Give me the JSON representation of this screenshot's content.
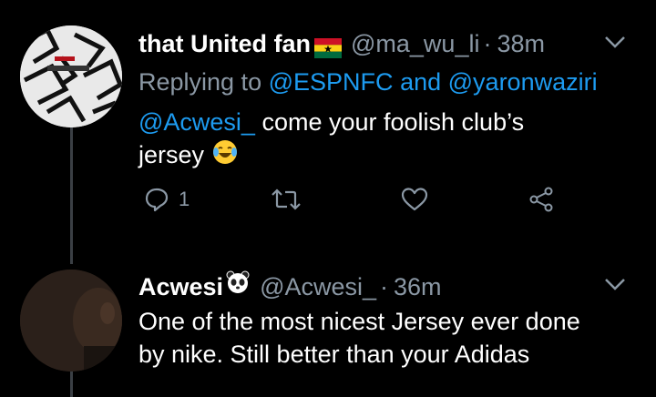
{
  "tweets": [
    {
      "display_name": "that United fan",
      "name_flag": "ghana-flag-emoji",
      "handle": "@ma_wu_li",
      "separator": "·",
      "time": "38m",
      "replying_prefix": "Replying to",
      "replying_to_1": "@ESPNFC",
      "replying_and": "and",
      "replying_to_2": "@yaronwaziri",
      "mention": "@Acwesi_",
      "body_after_mention": " come your foolish club’s",
      "body_line2": "jersey",
      "body_emoji": "tears-of-joy-emoji",
      "reply_count": "1"
    },
    {
      "display_name": "Acwesi",
      "name_emoji": "panda-face-emoji",
      "handle": "@Acwesi_",
      "separator": "·",
      "time": "36m",
      "body_line1": "One of the most nicest Jersey ever done",
      "body_line2": "by nike.  Still better than your Adidas"
    }
  ],
  "colors": {
    "background": "#000000",
    "secondary_text": "#8b98a5",
    "link": "#1d9bf0",
    "thread_line": "#3a3f44"
  }
}
